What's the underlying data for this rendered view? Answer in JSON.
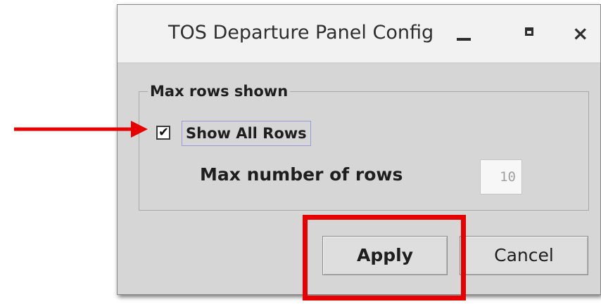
{
  "window": {
    "title": "TOS Departure Panel Config",
    "controls": {
      "minimize_icon": "minimize-icon",
      "maximize_icon": "maximize-icon",
      "close_icon": "close-icon"
    }
  },
  "group": {
    "legend": "Max rows shown",
    "show_all": {
      "label": "Show All Rows",
      "checked": true
    },
    "max_rows": {
      "label": "Max number of rows",
      "value": "10"
    }
  },
  "buttons": {
    "apply_label": "Apply",
    "cancel_label": "Cancel"
  },
  "annotations": {
    "color": "#e60000",
    "arrow_target": "show-all-rows-checkbox",
    "highlight_target": "apply-button"
  }
}
